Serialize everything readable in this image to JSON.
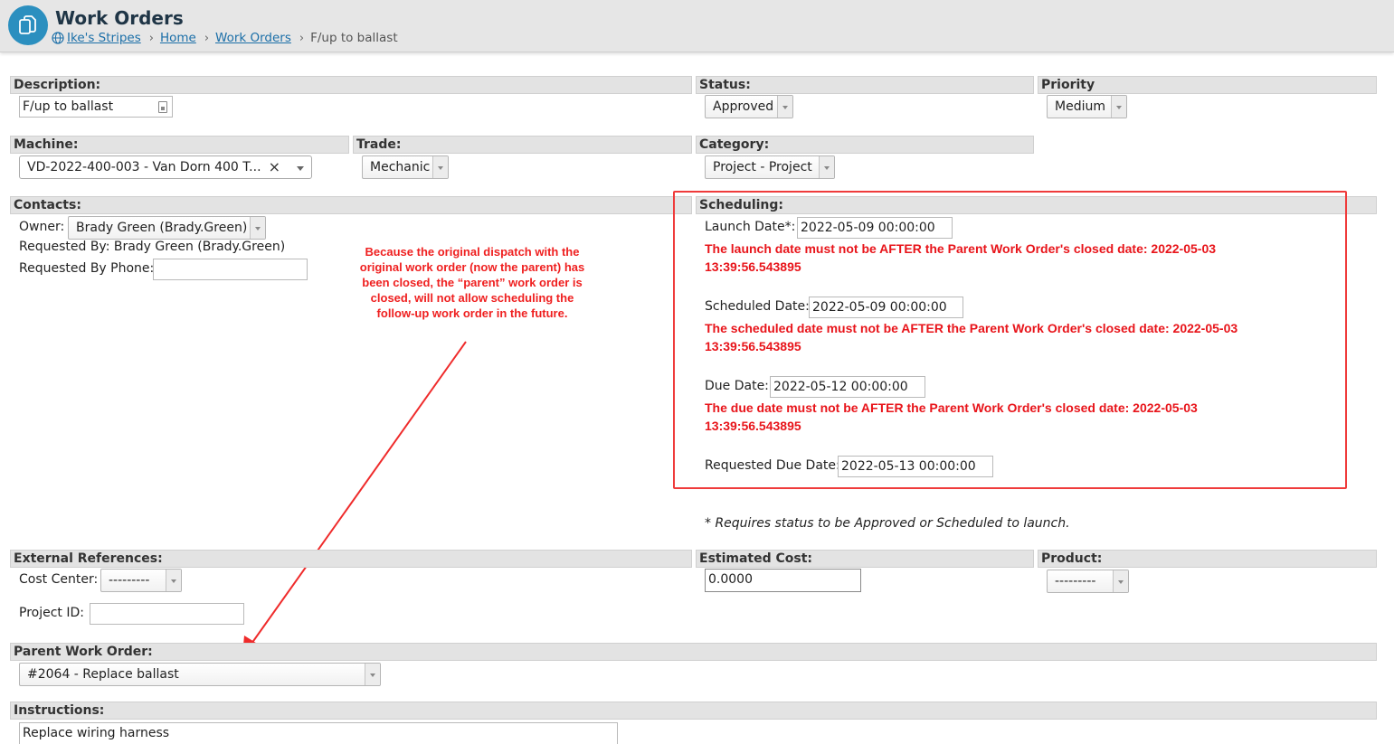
{
  "header": {
    "title": "Work Orders",
    "breadcrumb": {
      "site": "Ike's Stripes",
      "home": "Home",
      "work_orders": "Work Orders",
      "current": "F/up to ballast",
      "separator": "›"
    }
  },
  "sections": {
    "description": "Description:",
    "status": "Status:",
    "priority": "Priority",
    "machine": "Machine:",
    "trade": "Trade:",
    "category": "Category:",
    "contacts": "Contacts:",
    "scheduling": "Scheduling:",
    "external_refs": "External References:",
    "estimated_cost": "Estimated Cost:",
    "product": "Product:",
    "parent_work_order": "Parent Work Order:",
    "instructions": "Instructions:"
  },
  "fields": {
    "description_value": "F/up to ballast",
    "status_value": "Approved",
    "priority_value": "Medium",
    "machine_value": "VD-2022-400-003 - Van Dorn 400 T...",
    "machine_clear": "×",
    "trade_value": "Mechanic",
    "category_value": "Project - Project",
    "owner_label": "Owner:",
    "owner_value": "Brady Green (Brady.Green)",
    "requested_by": "Requested By: Brady Green (Brady.Green)",
    "requested_phone_label": "Requested By Phone:",
    "requested_phone_value": "",
    "launch_label": "Launch Date*:",
    "launch_value": "2022-05-09 00:00:00",
    "scheduled_label": "Scheduled Date:",
    "scheduled_value": "2022-05-09 00:00:00",
    "due_label": "Due Date:",
    "due_value": "2022-05-12 00:00:00",
    "requested_due_label": "Requested Due Date:",
    "requested_due_value": "2022-05-13 00:00:00",
    "cost_center_label": "Cost Center:",
    "cost_center_value": "---------",
    "project_id_label": "Project ID:",
    "project_id_value": "",
    "estimated_cost_value": "0.0000",
    "product_value": "---------",
    "parent_wo_value": "#2064 - Replace ballast",
    "instructions_value": "Replace wiring harness"
  },
  "errors": {
    "launch_1": "The launch date must not be AFTER the Parent Work Order's closed date: 2022-05-03",
    "launch_2": "13:39:56.543895",
    "scheduled_1": "The scheduled date must not be AFTER the Parent Work Order's closed date: 2022-05-03",
    "scheduled_2": "13:39:56.543895",
    "due_1": "The due date must not be AFTER the Parent Work Order's closed date: 2022-05-03",
    "due_2": "13:39:56.543895"
  },
  "note": "* Requires status to be Approved or Scheduled to launch.",
  "annotation": "Because the original dispatch with the original work order (now the parent) has been closed, the “parent” work order is closed, will not allow scheduling the follow-up work order in the future.",
  "colors": {
    "accent": "#2b8fbf",
    "error": "#e8141a",
    "annotation": "#ef2020",
    "section_bg": "#e3e3e3"
  },
  "icons": {
    "app": "documents-copy-icon",
    "site": "globe-icon",
    "autofill": "contact-card-icon"
  }
}
